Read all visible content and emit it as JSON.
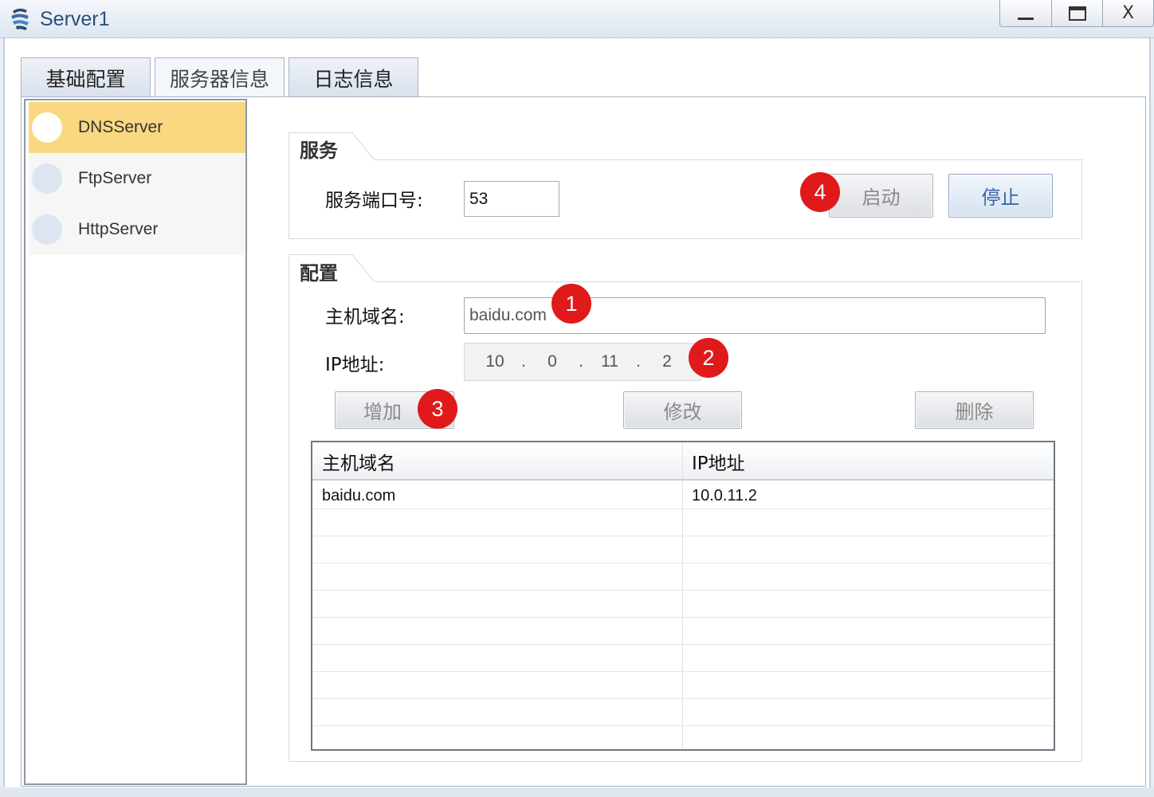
{
  "window": {
    "title": "Server1",
    "minimize": "",
    "maximize": "",
    "close": "X"
  },
  "tabs": [
    {
      "label": "基础配置"
    },
    {
      "label": "服务器信息"
    },
    {
      "label": "日志信息"
    }
  ],
  "services": [
    {
      "label": "DNSServer",
      "selected": true
    },
    {
      "label": "FtpServer",
      "selected": false
    },
    {
      "label": "HttpServer",
      "selected": false
    }
  ],
  "service_group": {
    "title": "服务",
    "port_label": "服务端口号:",
    "port_value": "53",
    "start_label": "启动",
    "stop_label": "停止"
  },
  "config_group": {
    "title": "配置",
    "host_label": "主机域名:",
    "host_value": "baidu.com",
    "ip_label": "IP地址:",
    "ip": [
      "10",
      "0",
      "11",
      "2"
    ],
    "ip_sep": ".",
    "add_label": "增加",
    "modify_label": "修改",
    "delete_label": "删除"
  },
  "table": {
    "columns": [
      "主机域名",
      "IP地址"
    ],
    "rows": [
      {
        "host": "baidu.com",
        "ip": "10.0.11.2"
      }
    ]
  },
  "badges": [
    "1",
    "2",
    "3",
    "4"
  ],
  "colors": {
    "badge": "#e0191b",
    "selected_item": "#fad882",
    "active_button_text": "#3766a5",
    "title_text": "#2a4f7a"
  }
}
